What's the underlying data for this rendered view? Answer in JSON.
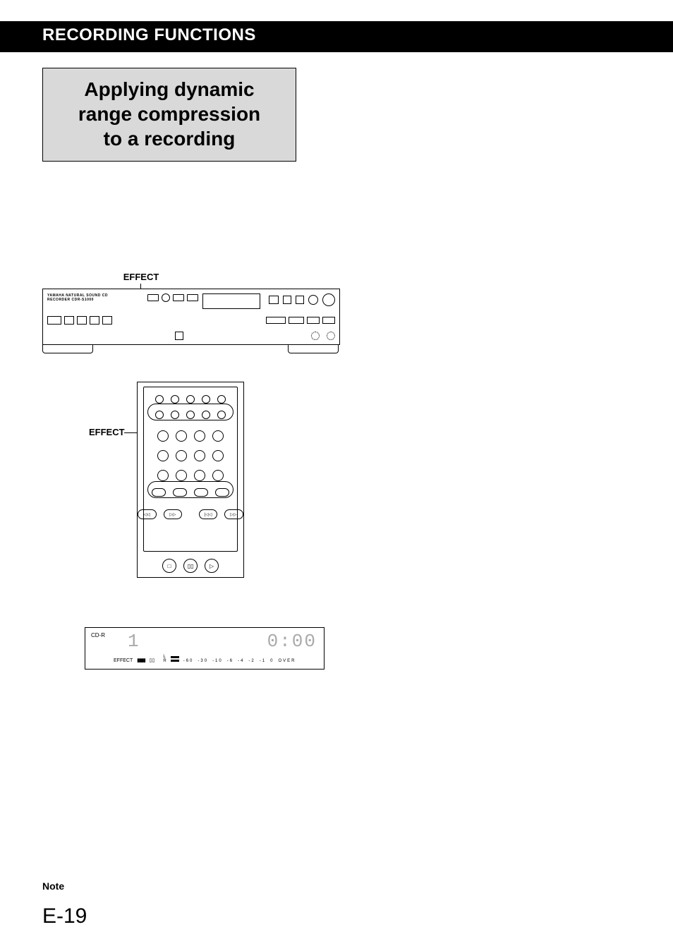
{
  "header": {
    "section_title": "RECORDING FUNCTIONS"
  },
  "title": {
    "line1": "Applying dynamic",
    "line2": "range compression",
    "line3": "to a recording"
  },
  "front_panel": {
    "callout_label": "EFFECT",
    "brand_text": "YAMAHA NATURAL SOUND CD RECORDER CDR-S1000"
  },
  "remote": {
    "callout_label": "EFFECT",
    "transport_icons": {
      "stop": "□",
      "pause": "▯▯",
      "play": "▷"
    },
    "search_icons": {
      "rev_scan": "◁◁",
      "fwd_scan": "▷▷",
      "prev": "|◁◁",
      "next": "▷▷|"
    }
  },
  "display": {
    "disc_type": "CD-R",
    "track_number": "1",
    "time_value": "0:00",
    "indicator_effect": "EFFECT",
    "indicator_pause": "▮▮▮▮",
    "indicator_rec": "▯▯",
    "channels": {
      "left": "L",
      "right": "R"
    },
    "level_ticks": [
      "-60",
      "-30",
      "-10",
      "-6",
      "-4",
      "-2",
      "-1",
      "0",
      "OVER"
    ]
  },
  "footer": {
    "note_label": "Note",
    "page_number": "E-19"
  }
}
